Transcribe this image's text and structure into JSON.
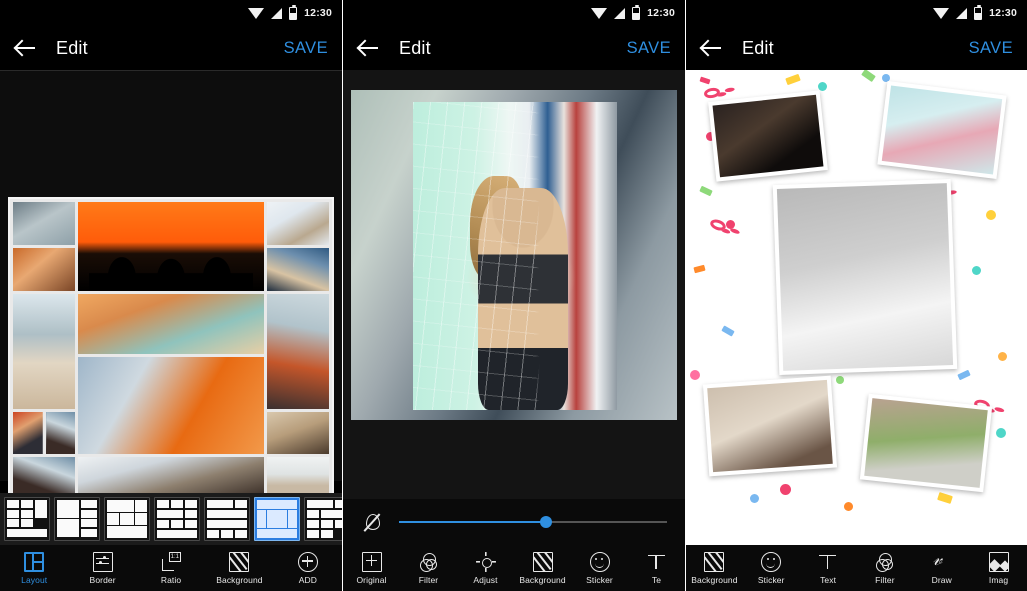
{
  "app": {
    "status_bar": {
      "time": "12:30",
      "icons": [
        "wifi-icon",
        "signal-icon",
        "battery-icon"
      ]
    },
    "appbar": {
      "back_icon": "back-arrow-icon",
      "title": "Edit",
      "save_label": "SAVE"
    },
    "accent_color": "#2f8fe0",
    "save_color": "#2f8fe0"
  },
  "panels": [
    {
      "id": "collage-layout-screen",
      "appbar_title": "Edit",
      "save_label": "SAVE",
      "tabs": [
        {
          "label": "Layout",
          "icon": "layout-icon",
          "active": true
        },
        {
          "label": "Border",
          "icon": "border-icon",
          "active": false
        },
        {
          "label": "Ratio",
          "icon": "ratio-icon",
          "active": false
        },
        {
          "label": "Background",
          "icon": "background-icon",
          "active": false
        },
        {
          "label": "ADD",
          "icon": "add-icon",
          "active": false
        }
      ],
      "layout_thumbnails": [
        {
          "name": "layout-1",
          "selected": false
        },
        {
          "name": "layout-2",
          "selected": false
        },
        {
          "name": "layout-3",
          "selected": false
        },
        {
          "name": "layout-4",
          "selected": false
        },
        {
          "name": "layout-5",
          "selected": false
        },
        {
          "name": "layout-6",
          "selected": true
        },
        {
          "name": "layout-7",
          "selected": false
        }
      ],
      "collage_cells": [
        "woman-lying-portrait",
        "woman-autumn-leaves",
        "friends-sunset-silhouette",
        "blonde-selfie",
        "blonde-blue-top",
        "woman-beach-towel",
        "smiling-woman-necklace",
        "woman-graphic-tshirt",
        "woman-orange-dress",
        "redhead-profile",
        "woman-knit-hat-portrait",
        "woman-feather-headdress",
        "woman-winter-coat",
        "couple-walking",
        "woman-snow-field"
      ]
    },
    {
      "id": "photo-adjust-screen",
      "appbar_title": "Edit",
      "save_label": "SAVE",
      "photo": "woman-teal-tile-wall",
      "slider": {
        "icon": "blur-off-icon",
        "value": 55,
        "min": 0,
        "max": 100
      },
      "tabs": [
        {
          "label": "Original",
          "icon": "original-icon",
          "active": false
        },
        {
          "label": "Filter",
          "icon": "filter-icon",
          "active": false
        },
        {
          "label": "Adjust",
          "icon": "adjust-icon",
          "active": false
        },
        {
          "label": "Background",
          "icon": "background-icon",
          "active": false
        },
        {
          "label": "Sticker",
          "icon": "sticker-icon",
          "active": false
        },
        {
          "label": "Te",
          "icon": "text-icon",
          "active": false
        }
      ]
    },
    {
      "id": "scrapbook-screen",
      "appbar_title": "Edit",
      "save_label": "SAVE",
      "photos": [
        "birthday-candles-night",
        "party-treats-flatlay",
        "girl-confetti-wall",
        "party-staircase-decor",
        "dog-party-hat"
      ],
      "tabs": [
        {
          "label": "Background",
          "icon": "background-icon",
          "active": false
        },
        {
          "label": "Sticker",
          "icon": "sticker-icon",
          "active": false
        },
        {
          "label": "Text",
          "icon": "text-icon",
          "active": false
        },
        {
          "label": "Filter",
          "icon": "filter-icon",
          "active": false
        },
        {
          "label": "Draw",
          "icon": "draw-icon",
          "active": false
        },
        {
          "label": "Imag",
          "icon": "image-icon",
          "active": false
        }
      ]
    }
  ]
}
